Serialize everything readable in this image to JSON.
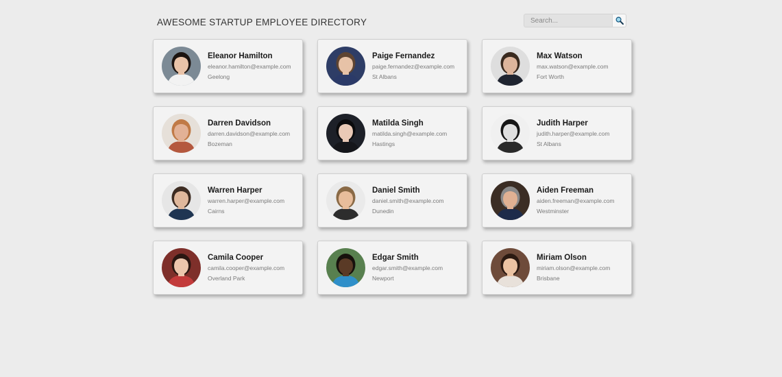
{
  "header": {
    "title": "AWESOME STARTUP EMPLOYEE DIRECTORY"
  },
  "search": {
    "placeholder": "Search...",
    "button_icon": "search-icon"
  },
  "employees": [
    {
      "name": "Eleanor Hamilton",
      "email": "eleanor.hamilton@example.com",
      "city": "Geelong",
      "bg": "#7c8a95",
      "skin": "#e9c3a8",
      "hair": "#1c1410",
      "shirt": "#f2f2f2"
    },
    {
      "name": "Paige Fernandez",
      "email": "paige.fernandez@example.com",
      "city": "St Albans",
      "bg": "#2e3d66",
      "skin": "#e7c2a7",
      "hair": "#5e4432",
      "shirt": "#2b3a68"
    },
    {
      "name": "Max Watson",
      "email": "max.watson@example.com",
      "city": "Fort Worth",
      "bg": "#dedede",
      "skin": "#ddb59c",
      "hair": "#3a2a1f",
      "shirt": "#1f2430"
    },
    {
      "name": "Darren Davidson",
      "email": "darren.davidson@example.com",
      "city": "Bozeman",
      "bg": "#e6e0d9",
      "skin": "#e2b196",
      "hair": "#c07a47",
      "shirt": "#b4583e"
    },
    {
      "name": "Matilda Singh",
      "email": "matilda.singh@example.com",
      "city": "Hastings",
      "bg": "#1d2028",
      "skin": "#e9c9b6",
      "hair": "#0b0b0d",
      "shirt": "#15161b"
    },
    {
      "name": "Judith Harper",
      "email": "judith.harper@example.com",
      "city": "St Albans",
      "bg": "#f0f0f0",
      "skin": "#dfdfdf",
      "hair": "#161616",
      "shirt": "#2a2a2a"
    },
    {
      "name": "Warren Harper",
      "email": "warren.harper@example.com",
      "city": "Cairns",
      "bg": "#e6e6e6",
      "skin": "#e0b89c",
      "hair": "#3d2c22",
      "shirt": "#1f3552"
    },
    {
      "name": "Daniel Smith",
      "email": "daniel.smith@example.com",
      "city": "Dunedin",
      "bg": "#eaeaea",
      "skin": "#e8bd9b",
      "hair": "#8a6a46",
      "shirt": "#2d2d2d"
    },
    {
      "name": "Aiden Freeman",
      "email": "aiden.freeman@example.com",
      "city": "Westminster",
      "bg": "#3b2d24",
      "skin": "#e0b193",
      "hair": "#8a8a8a",
      "shirt": "#1d2b4a"
    },
    {
      "name": "Camila Cooper",
      "email": "camila.cooper@example.com",
      "city": "Overland Park",
      "bg": "#7e2f2a",
      "skin": "#ecc6ad",
      "hair": "#2a1712",
      "shirt": "#c33b3b"
    },
    {
      "name": "Edgar Smith",
      "email": "edgar.smith@example.com",
      "city": "Newport",
      "bg": "#58804f",
      "skin": "#5a3a26",
      "hair": "#17110d",
      "shirt": "#2f8fc9"
    },
    {
      "name": "Miriam Olson",
      "email": "miriam.olson@example.com",
      "city": "Brisbane",
      "bg": "#6e4b3a",
      "skin": "#ebc3a3",
      "hair": "#2b1a12",
      "shirt": "#e8e1da"
    }
  ]
}
